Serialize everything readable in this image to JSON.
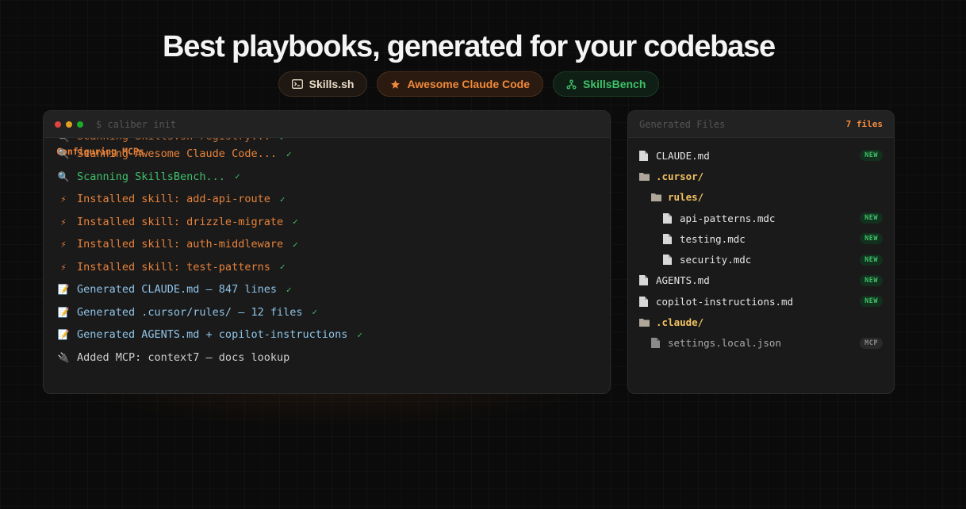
{
  "headline": "Best playbooks, generated for your codebase",
  "pills": [
    {
      "label": "Skills.sh",
      "icon": "terminal-icon"
    },
    {
      "label": "Awesome Claude Code",
      "icon": "star-icon"
    },
    {
      "label": "SkillsBench",
      "icon": "fork-icon"
    }
  ],
  "terminal": {
    "command": "$ caliber init",
    "overlay_label": "Configuring MCPs",
    "partial_line": "Scanning Skills.sh registry...",
    "lines": [
      {
        "icon": "🔍",
        "text": "Scanning Awesome Claude Code...",
        "check": "✓"
      },
      {
        "icon": "🔍",
        "text": "Scanning SkillsBench...",
        "check": "✓"
      },
      {
        "icon": "⚡",
        "text": "Installed skill: add-api-route",
        "check": "✓"
      },
      {
        "icon": "⚡",
        "text": "Installed skill: drizzle-migrate",
        "check": "✓"
      },
      {
        "icon": "⚡",
        "text": "Installed skill: auth-middleware",
        "check": "✓"
      },
      {
        "icon": "⚡",
        "text": "Installed skill: test-patterns",
        "check": "✓"
      },
      {
        "icon": "📝",
        "text": "Generated CLAUDE.md — 847 lines",
        "check": "✓"
      },
      {
        "icon": "📝",
        "text": "Generated .cursor/rules/ — 12 files",
        "check": "✓"
      },
      {
        "icon": "📝",
        "text": "Generated AGENTS.md + copilot-instructions",
        "check": "✓"
      },
      {
        "icon": "🔌",
        "text": "Added MCP: context7 — docs lookup",
        "check": ""
      }
    ]
  },
  "files_panel": {
    "title": "Generated Files",
    "count": "7 files",
    "tree": [
      {
        "name": "CLAUDE.md",
        "badge": "NEW"
      },
      {
        "name": ".cursor/",
        "badge": ""
      },
      {
        "name": "rules/",
        "badge": ""
      },
      {
        "name": "api-patterns.mdc",
        "badge": "NEW"
      },
      {
        "name": "testing.mdc",
        "badge": "NEW"
      },
      {
        "name": "security.mdc",
        "badge": "NEW"
      },
      {
        "name": "AGENTS.md",
        "badge": "NEW"
      },
      {
        "name": "copilot-instructions.md",
        "badge": "NEW"
      },
      {
        "name": ".claude/",
        "badge": ""
      },
      {
        "name": "settings.local.json",
        "badge": "MCP"
      }
    ]
  },
  "colors": {
    "accent_orange": "#f28a3c",
    "success_green": "#3fc16a",
    "folder_yellow": "#f0c060",
    "info_blue": "#8fc4e8"
  }
}
